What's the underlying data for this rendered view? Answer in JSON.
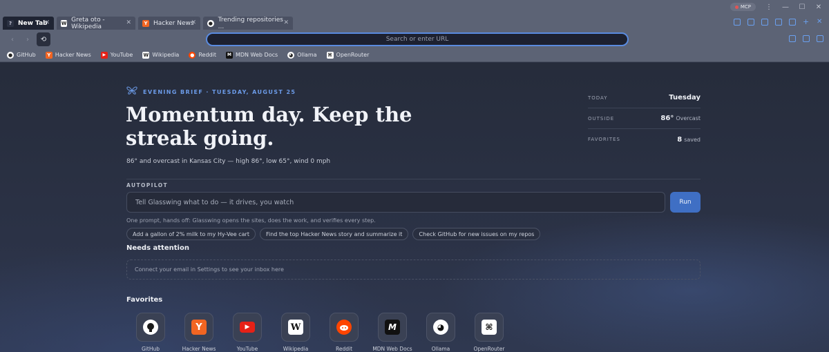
{
  "tabs": [
    {
      "label": "New Tab",
      "active": true,
      "icon": "question-favicon"
    },
    {
      "label": "Greta oto - Wikipedia",
      "active": false,
      "icon": "wikipedia-icon"
    },
    {
      "label": "Hacker News",
      "active": false,
      "icon": "hackernews-icon"
    },
    {
      "label": "Trending repositories ...",
      "active": false,
      "icon": "github-icon"
    }
  ],
  "window": {
    "mcp_label": "MCP",
    "mcp_status_color": "#e25555"
  },
  "toolbar": {
    "url_placeholder": "Search or enter URL"
  },
  "bookmarks": [
    {
      "label": "GitHub",
      "icon": "github-icon"
    },
    {
      "label": "Hacker News",
      "icon": "hackernews-icon"
    },
    {
      "label": "YouTube",
      "icon": "youtube-icon"
    },
    {
      "label": "Wikipedia",
      "icon": "wikipedia-icon"
    },
    {
      "label": "Reddit",
      "icon": "reddit-icon"
    },
    {
      "label": "MDN Web Docs",
      "icon": "mdn-icon"
    },
    {
      "label": "Ollama",
      "icon": "ollama-icon"
    },
    {
      "label": "OpenRouter",
      "icon": "openrouter-icon"
    }
  ],
  "brief": {
    "kicker": "EVENING BRIEF · TUESDAY, AUGUST 25",
    "headline": "Momentum day. Keep the streak going.",
    "weather": "86° and overcast in Kansas City — high 86°, low 65°, wind 0 mph"
  },
  "stats": {
    "today_label": "TODAY",
    "today_value": "Tuesday",
    "outside_label": "OUTSIDE",
    "outside_value": "86°",
    "outside_sub": "Overcast",
    "favorites_label": "FAVORITES",
    "favorites_value": "8",
    "favorites_sub": "saved"
  },
  "autopilot": {
    "label": "AUTOPILOT",
    "placeholder": "Tell Glasswing what to do — it drives, you watch",
    "run_label": "Run",
    "hint": "One prompt, hands off: Glasswing opens the sites, does the work, and verifies every step.",
    "chips": [
      "Add a gallon of 2% milk to my Hy-Vee cart",
      "Find the top Hacker News story and summarize it",
      "Check GitHub for new issues on my repos"
    ]
  },
  "needs_attention": {
    "title": "Needs attention",
    "message": "Connect your email in Settings to see your inbox here"
  },
  "favorites": {
    "title": "Favorites",
    "items": [
      {
        "label": "GitHub",
        "icon": "github-icon"
      },
      {
        "label": "Hacker News",
        "icon": "hackernews-icon"
      },
      {
        "label": "YouTube",
        "icon": "youtube-icon"
      },
      {
        "label": "Wikipedia",
        "icon": "wikipedia-icon"
      },
      {
        "label": "Reddit",
        "icon": "reddit-icon"
      },
      {
        "label": "MDN Web Docs",
        "icon": "mdn-icon"
      },
      {
        "label": "Ollama",
        "icon": "ollama-icon"
      },
      {
        "label": "OpenRouter",
        "icon": "openrouter-icon"
      }
    ]
  },
  "colors": {
    "accent": "#6c9be8",
    "run_button": "#3f6fc4",
    "url_focus": "#5a8be0"
  }
}
